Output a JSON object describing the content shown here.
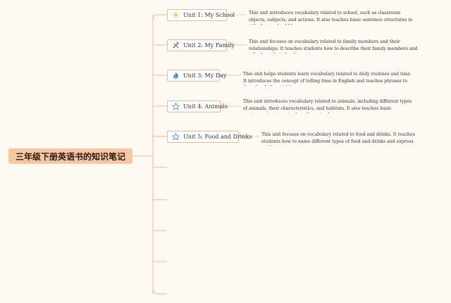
{
  "root": {
    "title": "三年级下册英语书的知识笔记"
  },
  "units": [
    {
      "label": "Unit 1: My School",
      "icon": "sun-icon",
      "description": "This unit introduces vocabulary related to school, such as classroom objects, subjects, and actions. It also teaches basic sentence structures to talk about school life."
    },
    {
      "label": "Unit 2: My Family",
      "icon": "tools-icon",
      "description": "This unit focuses on vocabulary related to family members and their relationships. It teaches students how to describe their family members and talk about their families using possessive pronouns."
    },
    {
      "label": "Unit 3: My Day",
      "icon": "flame-icon",
      "description": "This unit helps students learn vocabulary related to daily routines and time. It introduces the concept of telling time in English and teaches phrases to describe daily activities."
    },
    {
      "label": "Unit 4: Animals",
      "icon": "star-icon",
      "description": "This unit introduces vocabulary related to animals, including different types of animals, their characteristics, and habitats. It also teaches basic sentence structures to describe animals."
    },
    {
      "label": "Unit 5: Food and Drinks",
      "icon": "star-icon",
      "description": "This unit focuses on vocabulary related to food and drinks. It teaches students how to name different types of food and drinks and express preferences."
    }
  ],
  "colors": {
    "background": "#fefaf3",
    "root_fill": "#f7c6a3",
    "connector": "#f4b894",
    "node_border": "#f2b996",
    "star_icon": "#4a90d9",
    "flame_icon": "#3b7fd6",
    "sun_icon": "#f2c744"
  }
}
